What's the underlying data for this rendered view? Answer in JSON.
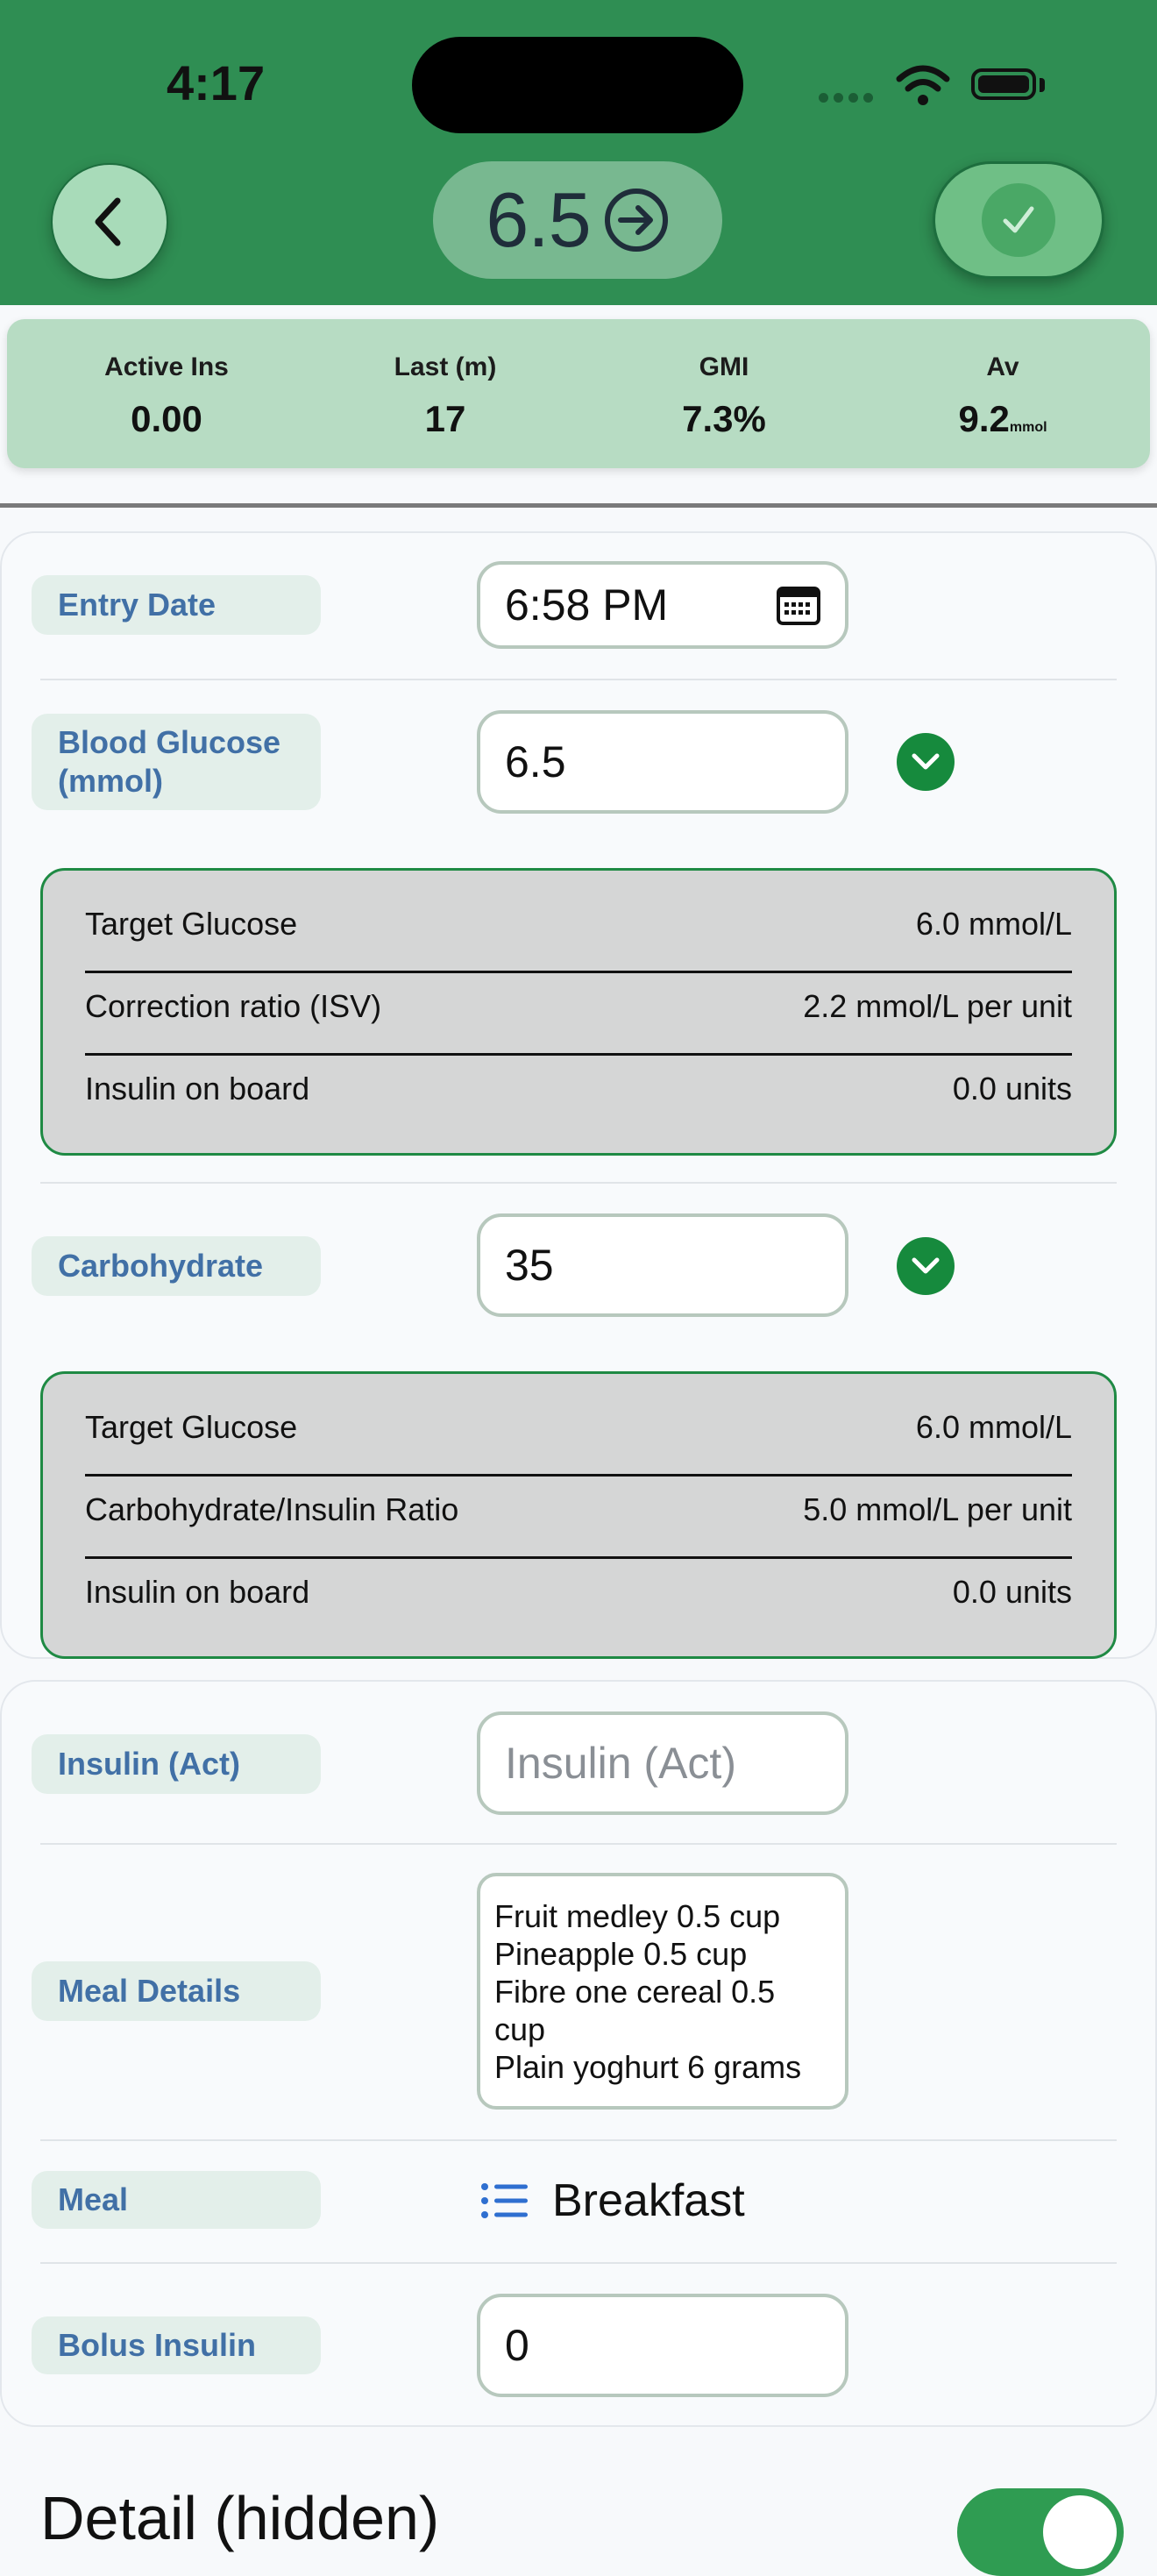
{
  "status_bar": {
    "time": "4:17"
  },
  "header": {
    "title_value": "6.5",
    "back_icon": "chevron-left-icon",
    "title_icon": "arrow-right-circle-icon",
    "confirm_icon": "checkmark-icon"
  },
  "stats": [
    {
      "label": "Active Ins",
      "value": "0.00",
      "unit": ""
    },
    {
      "label": "Last (m)",
      "value": "17",
      "unit": ""
    },
    {
      "label": "GMI",
      "value": "7.3%",
      "unit": ""
    },
    {
      "label": "Av",
      "value": "9.2",
      "unit": "mmol"
    }
  ],
  "form": {
    "entry_date": {
      "label": "Entry Date",
      "value": "6:58 PM",
      "icon": "calendar-icon"
    },
    "blood_glucose": {
      "label": "Blood Glucose (mmol)",
      "value": "6.5",
      "details": [
        {
          "label": "Target Glucose",
          "value": "6.0 mmol/L"
        },
        {
          "label": "Correction ratio (ISV)",
          "value": "2.2 mmol/L per unit"
        },
        {
          "label": "Insulin on board",
          "value": "0.0 units"
        }
      ]
    },
    "carbohydrate": {
      "label": "Carbohydrate",
      "value": "35",
      "details": [
        {
          "label": "Target Glucose",
          "value": "6.0 mmol/L"
        },
        {
          "label": "Carbohydrate/Insulin Ratio",
          "value": "5.0 mmol/L per unit"
        },
        {
          "label": "Insulin on board",
          "value": "0.0 units"
        }
      ]
    },
    "insulin_act": {
      "label": "Insulin (Act)",
      "placeholder": "Insulin (Act)"
    },
    "meal_details": {
      "label": "Meal Details",
      "lines": [
        "Fruit medley 0.5 cup",
        "Pineapple 0.5 cup",
        "Fibre one cereal 0.5",
        "cup",
        "Plain yoghurt 6 grams"
      ]
    },
    "meal": {
      "label": "Meal",
      "value": "Breakfast",
      "icon": "list-icon"
    },
    "bolus_insulin": {
      "label": "Bolus Insulin",
      "value": "0"
    }
  },
  "detail_section": {
    "label": "Detail (hidden)",
    "toggle_on": true
  },
  "colors": {
    "header_green": "#2f8e53",
    "stats_green": "#b7dcc3",
    "label_blue": "#4170a6",
    "check_green": "#168a3d",
    "panel_border": "#1f8a44"
  }
}
